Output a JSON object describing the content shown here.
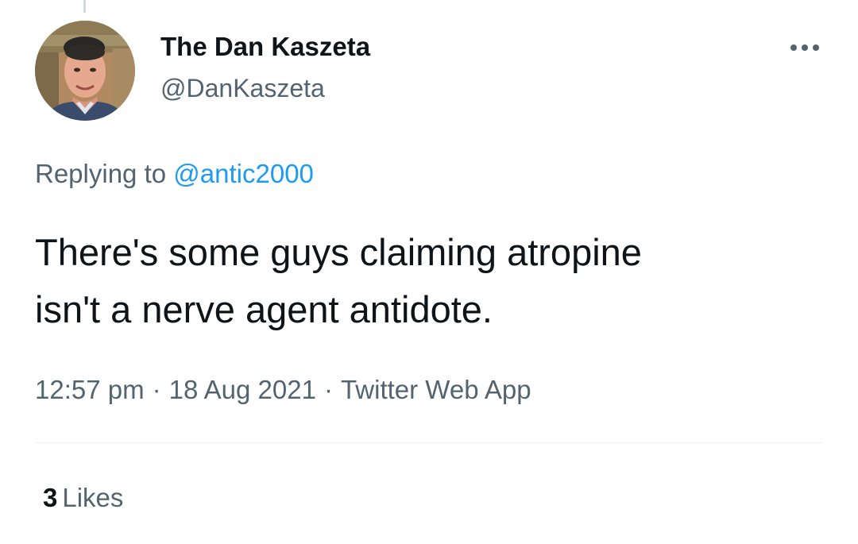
{
  "tweet": {
    "author": {
      "display_name": "The Dan Kaszeta",
      "handle": "@DanKaszeta"
    },
    "more_icon": "more-dots-icon",
    "reply_context": {
      "prefix": "Replying to",
      "mention": "@antic2000"
    },
    "text_lines": [
      "There's some guys claiming atropine",
      "isn't a nerve agent antidote."
    ],
    "meta": {
      "time": "12:57 pm",
      "separator": "·",
      "date": "18 Aug 2021",
      "source": "Twitter Web App"
    },
    "stats": {
      "likes_count": "3",
      "likes_label": "Likes"
    }
  },
  "colors": {
    "primary_text": "#0f1419",
    "secondary_text": "#536471",
    "link": "#1d9bf0",
    "divider": "#eff3f4"
  }
}
